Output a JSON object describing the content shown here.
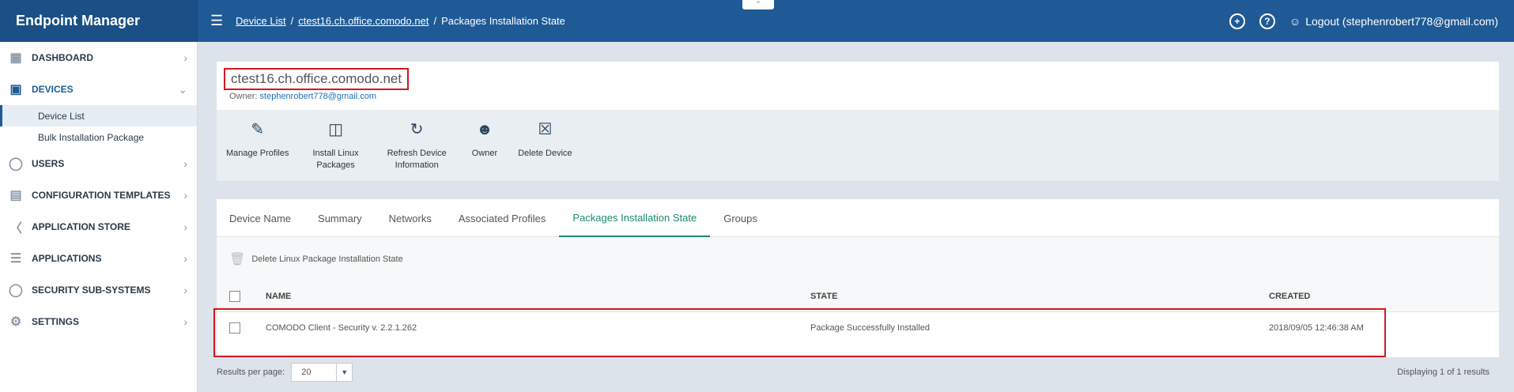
{
  "app": {
    "title": "Endpoint Manager"
  },
  "header": {
    "breadcrumbs": [
      "Device List",
      "ctest16.ch.office.comodo.net",
      "Packages Installation State"
    ],
    "logout_label": "Logout (stephenrobert778@gmail.com)"
  },
  "sidebar": {
    "items": [
      {
        "label": "DASHBOARD",
        "icon": "dashboard-icon"
      },
      {
        "label": "DEVICES",
        "icon": "devices-icon"
      },
      {
        "label": "USERS",
        "icon": "user-icon"
      },
      {
        "label": "CONFIGURATION TEMPLATES",
        "icon": "config-templates-icon"
      },
      {
        "label": "APPLICATION STORE",
        "icon": "store-basket-icon"
      },
      {
        "label": "APPLICATIONS",
        "icon": "applications-icon"
      },
      {
        "label": "SECURITY SUB-SYSTEMS",
        "icon": "shield-icon"
      },
      {
        "label": "SETTINGS",
        "icon": "gear-icon"
      }
    ],
    "devices_sub": [
      "Device List",
      "Bulk Installation Package"
    ]
  },
  "device": {
    "name": "ctest16.ch.office.comodo.net",
    "owner_label": "Owner:",
    "owner_email": "stephenrobert778@gmail.com"
  },
  "toolbar": {
    "manage_profiles": "Manage Profiles",
    "install_linux_1": "Install Linux",
    "install_linux_2": "Packages",
    "refresh_1": "Refresh Device",
    "refresh_2": "Information",
    "owner": "Owner",
    "delete_device": "Delete Device"
  },
  "tabs": [
    "Device Name",
    "Summary",
    "Networks",
    "Associated Profiles",
    "Packages Installation State",
    "Groups"
  ],
  "active_tab": "Packages Installation State",
  "actions": {
    "delete_label": "Delete Linux Package Installation State"
  },
  "table": {
    "headers": {
      "name": "NAME",
      "state": "STATE",
      "created": "CREATED"
    },
    "rows": [
      {
        "name": "COMODO Client - Security v. 2.2.1.262",
        "state": "Package Successfully Installed",
        "created": "2018/09/05 12:46:38 AM"
      }
    ]
  },
  "footer": {
    "results_per_page_label": "Results per page:",
    "results_per_page_value": "20",
    "displaying": "Displaying 1 of 1 results"
  },
  "colors": {
    "header_bg": "#1f5a96",
    "active_tab": "#1a8a6e",
    "highlight": "#d0191f"
  }
}
